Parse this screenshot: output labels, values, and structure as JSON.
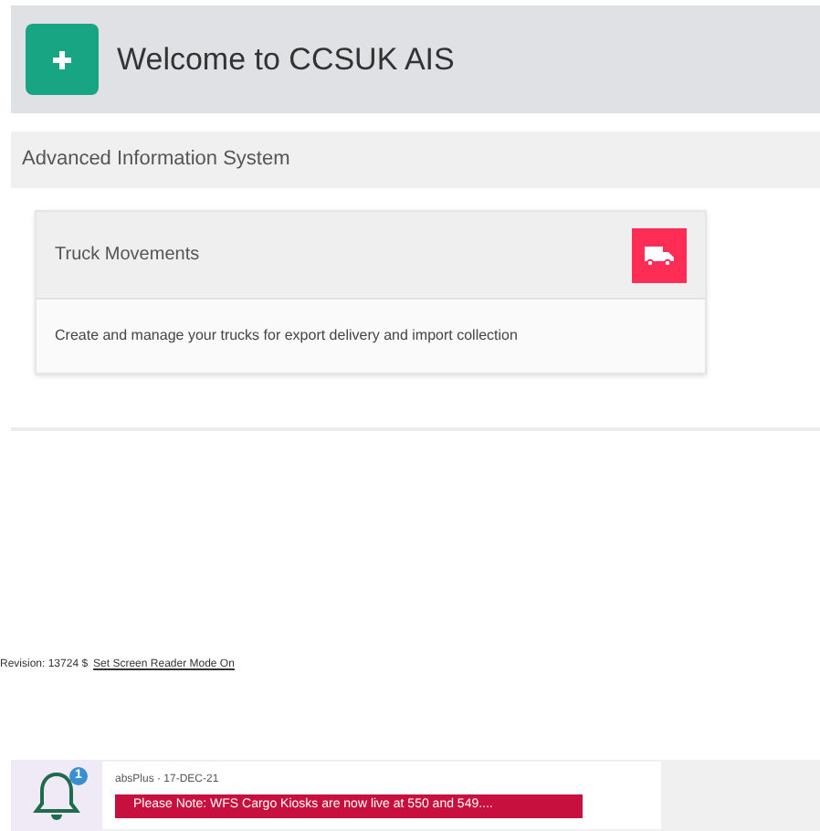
{
  "header": {
    "title": "Welcome to CCSUK AIS"
  },
  "section": {
    "title": "Advanced Information System"
  },
  "card": {
    "title": "Truck Movements",
    "description": "Create and manage your trucks for export delivery and import collection"
  },
  "footer": {
    "revision": "Revision: 13724 $",
    "link": "Set Screen Reader Mode On"
  },
  "notification": {
    "count": "1",
    "meta": "absPlus · 17-DEC-21",
    "message": "Please Note: WFS Cargo Kiosks are now live at 550 and 549...."
  }
}
